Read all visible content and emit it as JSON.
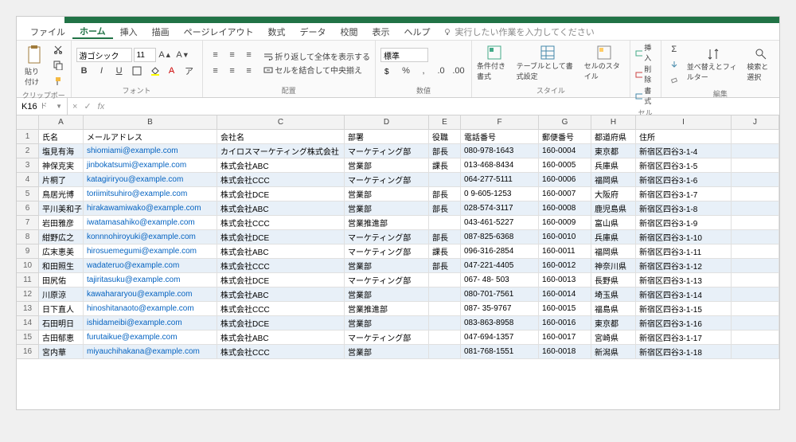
{
  "menu": {
    "file": "ファイル",
    "home": "ホーム",
    "insert": "挿入",
    "draw": "描画",
    "layout": "ページレイアウト",
    "formula": "数式",
    "data": "データ",
    "review": "校閲",
    "view": "表示",
    "help": "ヘルプ",
    "search_placeholder": "実行したい作業を入力してください"
  },
  "ribbon": {
    "clipboard": {
      "paste": "貼り付け",
      "label": "クリップボード"
    },
    "font": {
      "name": "游ゴシック",
      "size": "11",
      "label": "フォント"
    },
    "align": {
      "wrap": "折り返して全体を表示する",
      "merge": "セルを結合して中央揃え",
      "label": "配置"
    },
    "number": {
      "format": "標準",
      "label": "数値"
    },
    "styles": {
      "cond": "条件付き書式",
      "table": "テーブルとして書式設定",
      "cell": "セルのスタイル",
      "label": "スタイル"
    },
    "cells": {
      "insert": "挿入",
      "delete": "削除",
      "format": "書式",
      "label": "セル"
    },
    "edit": {
      "sort": "並べ替えとフィルター",
      "find": "検索と選択",
      "label": "編集"
    }
  },
  "namebox": "K16",
  "cols": [
    "A",
    "B",
    "C",
    "D",
    "E",
    "F",
    "G",
    "H",
    "I",
    "J"
  ],
  "header": {
    "A": "氏名",
    "B": "メールアドレス",
    "C": "会社名",
    "D": "部署",
    "E": "役職",
    "F": "電話番号",
    "G": "郵便番号",
    "H": "都道府県",
    "I": "住所"
  },
  "rows": [
    {
      "n": 2,
      "A": "塩見有海",
      "B": "shiomiami@example.com",
      "C": "カイロスマーケティング株式会社",
      "D": "マーケティング部",
      "E": "部長",
      "F": "080-978-1643",
      "G": "160-0004",
      "H": "東京都",
      "I": "新宿区四谷3-1-4"
    },
    {
      "n": 3,
      "A": "神保克実",
      "B": "jinbokatsumi@example.com",
      "C": "株式会社ABC",
      "D": "営業部",
      "E": "課長",
      "F": "013-468-8434",
      "G": "160-0005",
      "H": "兵庫県",
      "I": "新宿区四谷3-1-5"
    },
    {
      "n": 4,
      "A": "片桐了",
      "B": "katagiriryou@example.com",
      "C": "株式会社CCC",
      "D": "マーケティング部",
      "E": "",
      "F": "064-277-5111",
      "G": "160-0006",
      "H": "福岡県",
      "I": "新宿区四谷3-1-6"
    },
    {
      "n": 5,
      "A": "鳥居光博",
      "B": "toriimitsuhiro@example.com",
      "C": "株式会社DCE",
      "D": "営業部",
      "E": "部長",
      "F": "0 9-605-1253",
      "G": "160-0007",
      "H": "大阪府",
      "I": "新宿区四谷3-1-7"
    },
    {
      "n": 6,
      "A": "平川美和子",
      "B": "hirakawamiwako@example.com",
      "C": "株式会社ABC",
      "D": "営業部",
      "E": "部長",
      "F": "028-574-3117",
      "G": "160-0008",
      "H": "鹿児島県",
      "I": "新宿区四谷3-1-8"
    },
    {
      "n": 7,
      "A": "岩田雅彦",
      "B": "iwatamasahiko@example.com",
      "C": "株式会社CCC",
      "D": "営業推進部",
      "E": "",
      "F": "043-461-5227",
      "G": "160-0009",
      "H": "富山県",
      "I": "新宿区四谷3-1-9"
    },
    {
      "n": 8,
      "A": "紺野広之",
      "B": "konnnohiroyuki@example.com",
      "C": "株式会社DCE",
      "D": "マーケティング部",
      "E": "部長",
      "F": "087-825-6368",
      "G": "160-0010",
      "H": "兵庫県",
      "I": "新宿区四谷3-1-10"
    },
    {
      "n": 9,
      "A": "広末恵美",
      "B": "hirosuemegumi@example.com",
      "C": "株式会社ABC",
      "D": "マーケティング部",
      "E": "課長",
      "F": "096-316-2854",
      "G": "160-0011",
      "H": "福岡県",
      "I": "新宿区四谷3-1-11"
    },
    {
      "n": 10,
      "A": "和田照生",
      "B": "wadateruo@example.com",
      "C": "株式会社CCC",
      "D": "営業部",
      "E": "部長",
      "F": "047-221-4405",
      "G": "160-0012",
      "H": "神奈川県",
      "I": "新宿区四谷3-1-12"
    },
    {
      "n": 11,
      "A": "田尻佑",
      "B": "tajiritasuku@example.com",
      "C": "株式会社DCE",
      "D": "マーケティング部",
      "E": "",
      "F": "067- 48- 503",
      "G": "160-0013",
      "H": "長野県",
      "I": "新宿区四谷3-1-13"
    },
    {
      "n": 12,
      "A": "川原涼",
      "B": "kawahararyou@example.com",
      "C": "株式会社ABC",
      "D": "営業部",
      "E": "",
      "F": "080-701-7561",
      "G": "160-0014",
      "H": "埼玉県",
      "I": "新宿区四谷3-1-14"
    },
    {
      "n": 13,
      "A": "日下直人",
      "B": "hinoshitanaoto@example.com",
      "C": "株式会社CCC",
      "D": "営業推進部",
      "E": "",
      "F": "087- 35-9767",
      "G": "160-0015",
      "H": "福島県",
      "I": "新宿区四谷3-1-15"
    },
    {
      "n": 14,
      "A": "石田明日",
      "B": "ishidameibi@example.com",
      "C": "株式会社DCE",
      "D": "営業部",
      "E": "",
      "F": "083-863-8958",
      "G": "160-0016",
      "H": "東京都",
      "I": "新宿区四谷3-1-16"
    },
    {
      "n": 15,
      "A": "古田郁恵",
      "B": "furutaikue@example.com",
      "C": "株式会社ABC",
      "D": "マーケティング部",
      "E": "",
      "F": "047-694-1357",
      "G": "160-0017",
      "H": "宮崎県",
      "I": "新宿区四谷3-1-17"
    },
    {
      "n": 16,
      "A": "宮内華",
      "B": "miyauchihakana@example.com",
      "C": "株式会社CCC",
      "D": "営業部",
      "E": "",
      "F": "081-768-1551",
      "G": "160-0018",
      "H": "新潟県",
      "I": "新宿区四谷3-1-18"
    }
  ]
}
